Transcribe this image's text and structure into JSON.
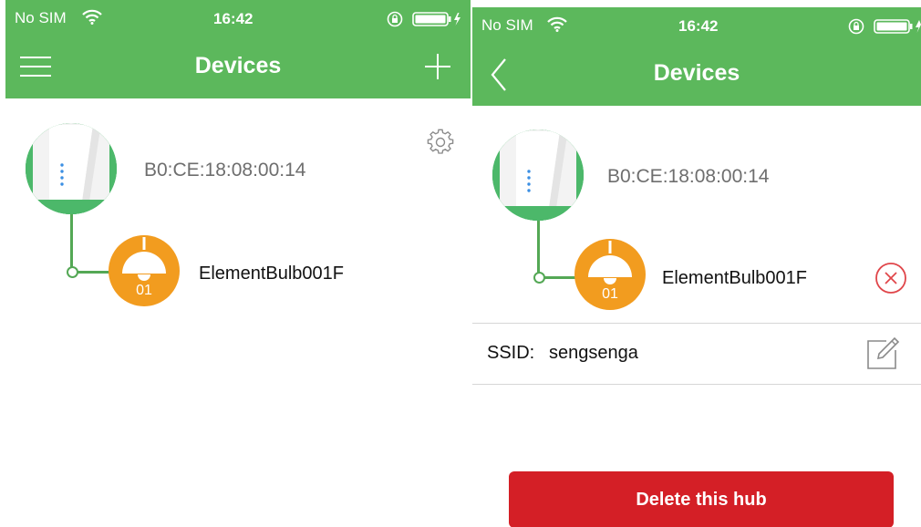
{
  "left_screen": {
    "status": {
      "carrier": "No SIM",
      "time": "16:42"
    },
    "nav": {
      "title": "Devices"
    },
    "hub": {
      "mac": "B0:CE:18:08:00:14"
    },
    "bulb": {
      "name": "ElementBulb001F",
      "number": "01"
    }
  },
  "right_screen": {
    "status": {
      "carrier": "No SIM",
      "time": "16:42"
    },
    "nav": {
      "title": "Devices"
    },
    "hub": {
      "mac": "B0:CE:18:08:00:14"
    },
    "bulb": {
      "name": "ElementBulb001F",
      "number": "01"
    },
    "ssid": {
      "label": "SSID:",
      "value": "sengsenga"
    },
    "delete_button": {
      "label": "Delete this hub"
    }
  },
  "colors": {
    "header_green": "#5cb85c",
    "tree_green": "#54a855",
    "bulb_orange": "#f29c1f",
    "delete_red": "#d41f26",
    "remove_icon_red": "#e0464a"
  },
  "icons": {
    "left": [
      "wifi-icon",
      "rotation-lock-icon",
      "battery-icon",
      "menu-icon",
      "plus-icon",
      "gear-icon",
      "lamp-icon"
    ],
    "right": [
      "wifi-icon",
      "rotation-lock-icon",
      "battery-icon",
      "back-chevron-icon",
      "lamp-icon",
      "remove-circle-icon",
      "edit-icon"
    ]
  }
}
